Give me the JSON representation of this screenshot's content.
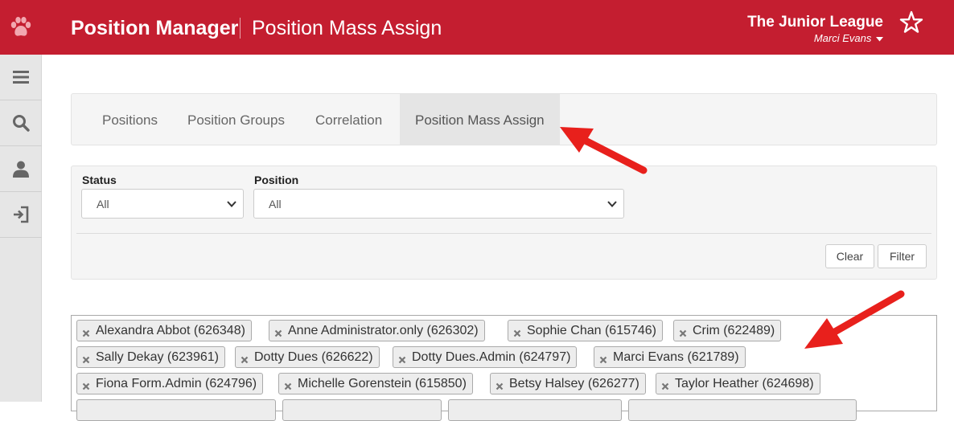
{
  "header": {
    "app_title": "Position Manager",
    "page_title": "Position Mass Assign",
    "org_name": "The Junior League",
    "user_name": "Marci Evans",
    "icons": [
      "paw-logo-icon",
      "star-icon",
      "caret-down-icon"
    ],
    "brand_color": "#c41e30"
  },
  "sidebar": {
    "items": [
      {
        "icon": "menu-icon"
      },
      {
        "icon": "search-icon"
      },
      {
        "icon": "user-icon"
      },
      {
        "icon": "logout-icon"
      }
    ]
  },
  "tabs": [
    {
      "label": "Positions",
      "active": false
    },
    {
      "label": "Position Groups",
      "active": false
    },
    {
      "label": "Correlation",
      "active": false
    },
    {
      "label": "Position Mass Assign",
      "active": true
    }
  ],
  "filters": {
    "status": {
      "label": "Status",
      "value": "All"
    },
    "position": {
      "label": "Position",
      "value": "All"
    },
    "clear_label": "Clear",
    "filter_label": "Filter"
  },
  "members": [
    "Alexandra Abbot (626348)",
    "Anne Administrator.only (626302)",
    "Sophie Chan (615746)",
    "Crim (622489)",
    "Sally Dekay (623961)",
    "Dotty Dues (626622)",
    "Dotty Dues.Admin (624797)",
    "Marci Evans (621789)",
    "Fiona Form.Admin (624796)",
    "Michelle Gorenstein (615850)",
    "Betsy Halsey (626277)",
    "Taylor Heather (624698)"
  ],
  "annotation_color": "#e8201c"
}
